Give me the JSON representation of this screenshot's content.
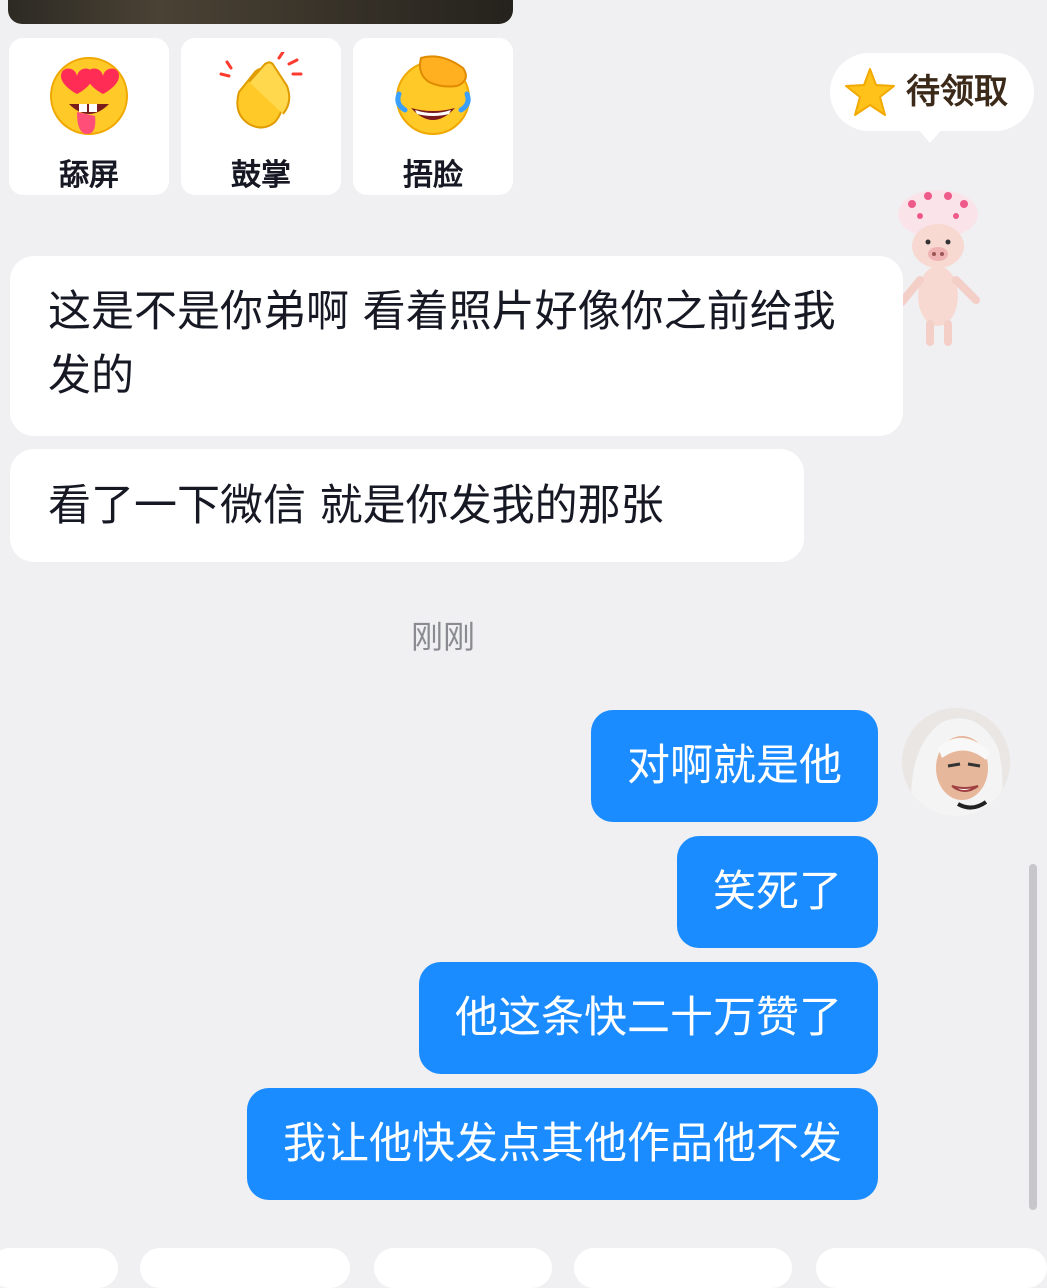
{
  "reactions": [
    {
      "label": "舔屏",
      "icon": "heart-eyes-tongue-emoji-icon"
    },
    {
      "label": "鼓掌",
      "icon": "clapping-hands-emoji-icon"
    },
    {
      "label": "捂脸",
      "icon": "facepalm-laughing-emoji-icon"
    }
  ],
  "reward_pill": {
    "label": "待领取",
    "icon": "star-icon"
  },
  "messages_in": [
    {
      "text": "这是不是你弟啊 看着照片好像你之前给我发的"
    },
    {
      "text": "看了一下微信 就是你发我的那张"
    }
  ],
  "timestamp": "刚刚",
  "messages_out": [
    {
      "text": "对啊就是他"
    },
    {
      "text": "笑死了"
    },
    {
      "text": "他这条快二十万赞了"
    },
    {
      "text": "我让他快发点其他作品他不发"
    }
  ],
  "colors": {
    "background": "#f0f0f2",
    "outgoing_bubble": "#1a8cff",
    "incoming_bubble": "#ffffff",
    "timestamp_text": "#8a8b91"
  }
}
